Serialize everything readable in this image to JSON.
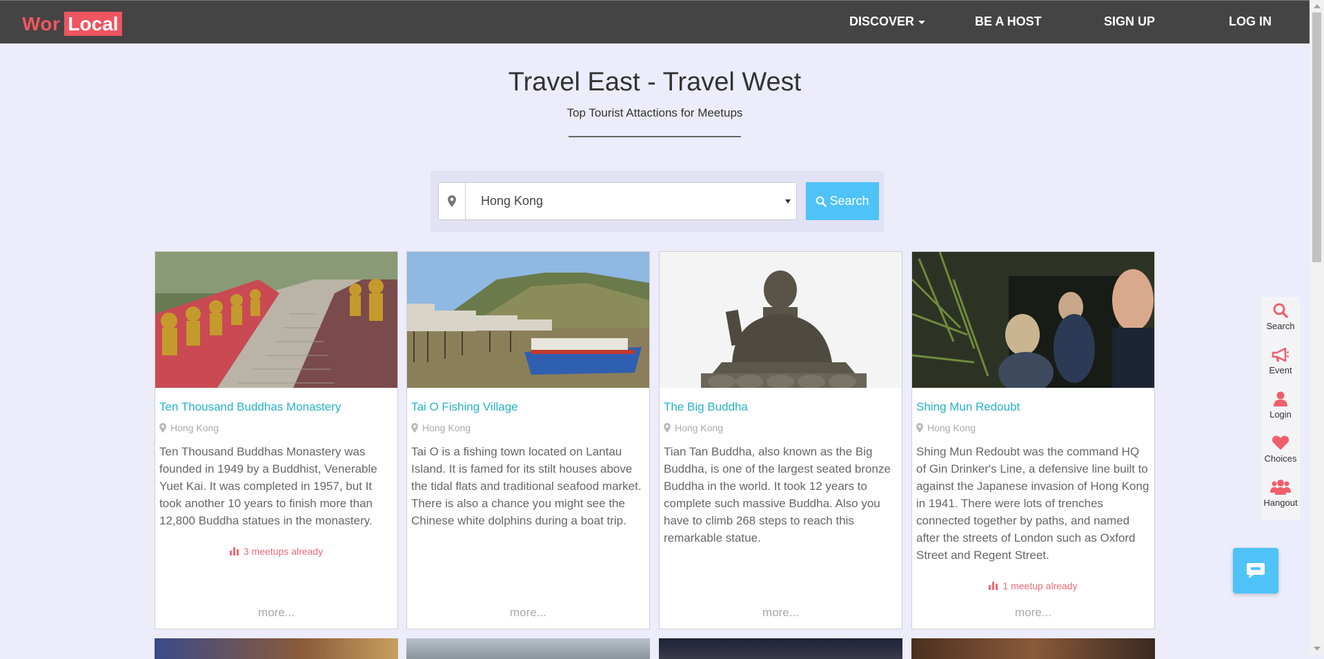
{
  "navbar": {
    "logo_part1": "Wor",
    "logo_part2": "Local",
    "discover": "DISCOVER",
    "be_a_host": "BE A HOST",
    "sign_up": "SIGN UP",
    "log_in": "LOG IN"
  },
  "hero": {
    "title": "Travel East - Travel West",
    "subtitle": "Top Tourist Attactions for Meetups"
  },
  "search": {
    "location_value": "Hong Kong",
    "button_label": "Search"
  },
  "cards": [
    {
      "title": "Ten Thousand Buddhas Monastery",
      "location": "Hong Kong",
      "description": "Ten Thousand Buddhas Monastery was founded in 1949 by a Buddhist, Venerable Yuet Kai. It was completed in 1957, but It took another 10 years to finish more than 12,800 Buddha statues in the monastery.",
      "meetups": "3 meetups already",
      "more": "more..."
    },
    {
      "title": "Tai O Fishing Village",
      "location": "Hong Kong",
      "description": "Tai O is a fishing town located on Lantau Island. It is famed for its stilt houses above the tidal flats and traditional seafood market. There is also a chance you might see the Chinese white dolphins during a boat trip.",
      "meetups": "",
      "more": "more..."
    },
    {
      "title": "The Big Buddha",
      "location": "Hong Kong",
      "description": "Tian Tan Buddha, also known as the Big Buddha, is one of the largest seated bronze Buddha in the world. It took 12 years to complete such massive Buddha. Also you have to climb 268 steps to reach this remarkable statue.",
      "meetups": "",
      "more": "more..."
    },
    {
      "title": "Shing Mun Redoubt",
      "location": "Hong Kong",
      "description": "Shing Mun Redoubt was the command HQ of Gin Drinker's Line, a defensive line built to against the Japanese invasion of Hong Kong in 1941. There were lots of trenches connected together by paths, and named after the streets of London such as Oxford Street and Regent Street.",
      "meetups": "1 meetup already",
      "more": "more..."
    }
  ],
  "sidebar": {
    "search": "Search",
    "event": "Event",
    "login": "Login",
    "choices": "Choices",
    "hangout": "Hangout"
  },
  "colors": {
    "accent_red": "#ef6a76",
    "accent_blue": "#4fc3f7",
    "link_teal": "#26b3c7",
    "nav_bg": "#454445",
    "page_bg": "#ececfb"
  }
}
